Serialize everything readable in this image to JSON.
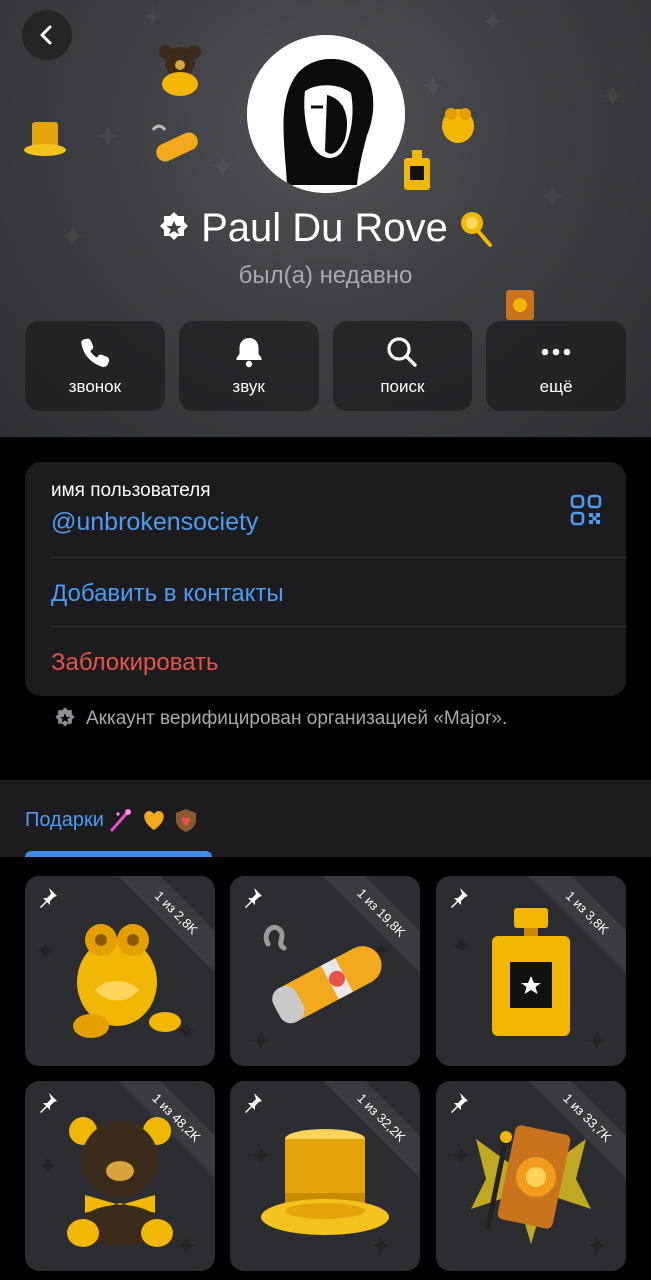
{
  "header": {
    "name": "Paul Du Rove",
    "status": "был(а) недавно",
    "actions": [
      {
        "label": "звонок",
        "icon": "phone-icon"
      },
      {
        "label": "звук",
        "icon": "bell-icon"
      },
      {
        "label": "поиск",
        "icon": "search-icon"
      },
      {
        "label": "ещё",
        "icon": "more-icon"
      }
    ]
  },
  "info": {
    "username_label": "имя пользователя",
    "username_value": "@unbrokensociety",
    "add_contact": "Добавить в контакты",
    "block": "Заблокировать",
    "verified_note": "Аккаунт верифицирован организацией «Major»."
  },
  "gifts": {
    "tab_label": "Подарки",
    "items": [
      {
        "counter": "1 из 2,8K",
        "name": "gold-frog"
      },
      {
        "counter": "1 из 19,8K",
        "name": "gold-cigar"
      },
      {
        "counter": "1 из 3,8K",
        "name": "perfume-bottle"
      },
      {
        "counter": "1 из 48,2K",
        "name": "teddy-bear"
      },
      {
        "counter": "1 из 32,2K",
        "name": "top-hat"
      },
      {
        "counter": "1 из 33,7K",
        "name": "magic-book"
      }
    ]
  },
  "colors": {
    "accent": "#4b9cf2",
    "danger": "#e5534b",
    "card": "#1c1c1e",
    "gold": "#f2b705"
  }
}
